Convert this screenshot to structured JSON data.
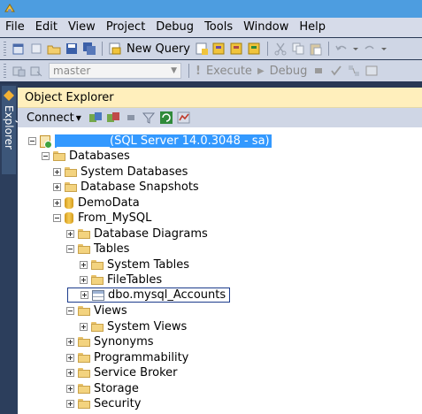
{
  "menu": [
    "File",
    "Edit",
    "View",
    "Project",
    "Debug",
    "Tools",
    "Window",
    "Help"
  ],
  "toolbar1": {
    "new_query_label": "New Query"
  },
  "toolbar2": {
    "database": "master",
    "execute_label": "Execute",
    "debug_label": "Debug"
  },
  "side_tab": {
    "label": "Object Explorer"
  },
  "object_explorer": {
    "title": "Object Explorer",
    "connect_label": "Connect",
    "server_label": "(SQL Server 14.0.3048 - sa)",
    "tree": [
      {
        "label": "Databases"
      },
      {
        "label": "System Databases"
      },
      {
        "label": "Database Snapshots"
      },
      {
        "label": "DemoData"
      },
      {
        "label": "From_MySQL"
      },
      {
        "label": "Database Diagrams"
      },
      {
        "label": "Tables"
      },
      {
        "label": "System Tables"
      },
      {
        "label": "FileTables"
      },
      {
        "label": "dbo.mysql_Accounts"
      },
      {
        "label": "Views"
      },
      {
        "label": "System Views"
      },
      {
        "label": "Synonyms"
      },
      {
        "label": "Programmability"
      },
      {
        "label": "Service Broker"
      },
      {
        "label": "Storage"
      },
      {
        "label": "Security"
      }
    ]
  }
}
